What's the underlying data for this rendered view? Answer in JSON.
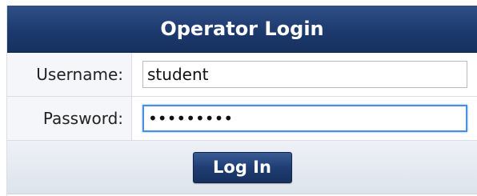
{
  "header": {
    "title": "Operator Login"
  },
  "username": {
    "label": "Username:",
    "value": "student"
  },
  "password": {
    "label": "Password:",
    "value": "•••••••••"
  },
  "actions": {
    "login_label": "Log In"
  }
}
